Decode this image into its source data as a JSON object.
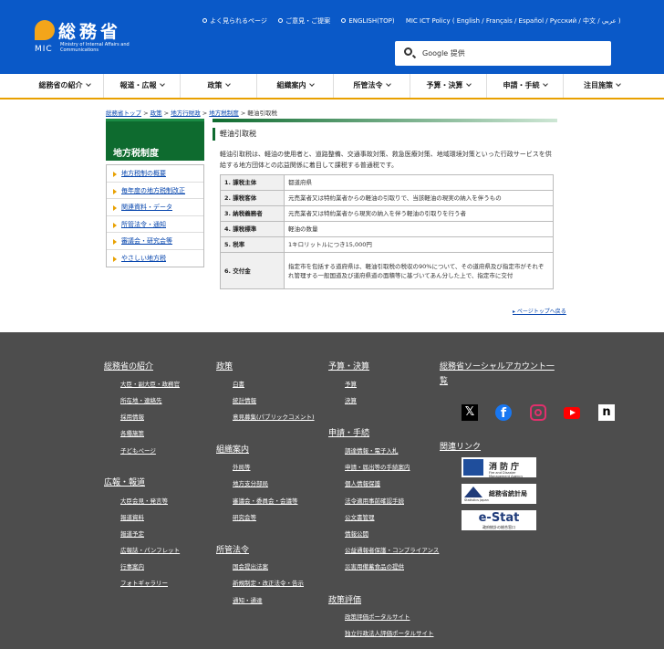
{
  "header": {
    "logo_kanji": "総務省",
    "logo_mic": "MIC",
    "logo_en": "Ministry of Internal Affairs and Communications",
    "top_links": [
      "よく見られるページ",
      "ご意見・ご提案",
      "ENGLISH(TOP)",
      "MIC ICT Policy ( English / Français / Español / Русский / 中文 / عربي )"
    ],
    "search_placeholder": "Google 提供"
  },
  "nav": [
    "総務省の紹介",
    "報道・広報",
    "政策",
    "組織案内",
    "所管法令",
    "予算・決算",
    "申請・手続",
    "注目施策"
  ],
  "breadcrumb": {
    "items": [
      "総務省トップ",
      "政策",
      "地方行財政",
      "地方税制度"
    ],
    "current": "軽油引取税"
  },
  "sidebar": {
    "title": "地方税制度",
    "items": [
      "地方税制の概要",
      "毎年度の地方税制改正",
      "関連資料・データ",
      "所管法令・通知",
      "審議会・研究会等",
      "やさしい地方税"
    ]
  },
  "main": {
    "title": "軽油引取税",
    "intro": "軽油引取税は、軽油の使用者と、道路整備、交通事故対策、救急医療対策、地域環境対策といった行政サービスを供給する地方団体との応益関係に着目して課税する普通税です。",
    "rows": [
      {
        "k": "1. 課税主体",
        "v": "都道府県"
      },
      {
        "k": "2. 課税客体",
        "v": "元売業者又は特約業者からの軽油の引取りで、当該軽油の現実の納入を伴うもの"
      },
      {
        "k": "3. 納税義務者",
        "v": "元売業者又は特約業者から現実の納入を伴う軽油の引取りを行う者"
      },
      {
        "k": "4. 課税標準",
        "v": "軽油の数量"
      },
      {
        "k": "5. 税率",
        "v": "1キロリットルにつき15,000円"
      },
      {
        "k": "6. 交付金",
        "v": "指定市を包括する道府県は、軽油引取税の税収の90%について、その道府県及び指定市がそれぞれ管理する一般国道及び道府県道の面積等に基づいてあん分した上で、指定市に交付"
      }
    ],
    "pagetop": "ページトップへ戻る"
  },
  "footer": {
    "col1": {
      "h1": "総務省の紹介",
      "l1": [
        "大臣・副大臣・政務官",
        "所在地・連絡先",
        "採用情報",
        "各種施策",
        "子どもページ"
      ],
      "h2": "広報・報道",
      "l2": [
        "大臣会見・発言等",
        "報道資料",
        "報道予定",
        "広報誌・パンフレット",
        "行事案内",
        "フォトギャラリー"
      ]
    },
    "col2": {
      "h1": "政策",
      "l1": [
        "白書",
        "統計情報",
        "意見募集(パブリックコメント)"
      ],
      "h2": "組織案内",
      "l2": [
        "外局等",
        "地方支分部局",
        "審議会・委員会・会議等",
        "研究会等"
      ],
      "h3": "所管法令",
      "l3": [
        "国会提出法案",
        "新規制定・改正法令・告示",
        "通知・通達"
      ]
    },
    "col3": {
      "h1": "予算・決算",
      "l1": [
        "予算",
        "決算"
      ],
      "h2": "申請・手続",
      "l2": [
        "調達情報・電子入札",
        "申請・届出等の手続案内",
        "個人情報保護",
        "法令適用事前確認手続",
        "公文書管理",
        "情報公開",
        "公益通報者保護・コンプライアンス",
        "災害用備蓄食品の提供"
      ],
      "h3": "政策評価",
      "l3": [
        "政策評価ポータルサイト",
        "独立行政法人評価ポータルサイト"
      ]
    },
    "col4": {
      "h1": "総務省ソーシャルアカウント一覧",
      "h2": "関連リンク",
      "banners": [
        "消防庁",
        "総務省統計局",
        "e-Stat"
      ],
      "banner_sub": [
        "Fire and Disaster Management Agency",
        "Statistics Japan",
        "政府統計の総合窓口"
      ]
    }
  },
  "colors": {
    "header": "#0a59c8",
    "accent": "#e8a000",
    "green": "#0e6b2f",
    "footer": "#4d4d4d"
  }
}
